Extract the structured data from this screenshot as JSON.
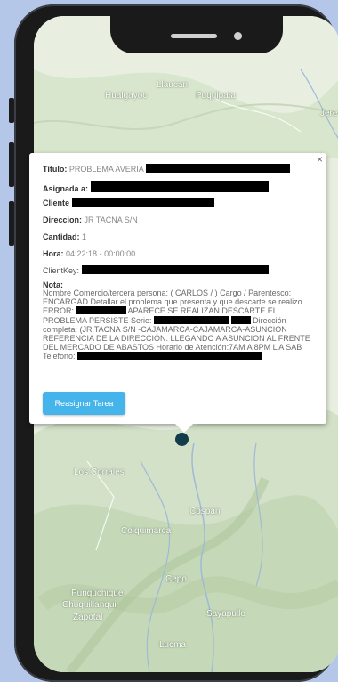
{
  "map": {
    "labels": {
      "llaucan": "Llaucan",
      "hualgayoc": "Hualgayoc",
      "puquipata": "Puquipata",
      "jere": "Jere",
      "los_corrales": "Los Corrales",
      "cospan": "Cospan",
      "colquimarca": "Colquimarca",
      "cepo": "Cepo",
      "punguchique": "Punguchique",
      "chuquillanqui": "Chuquillanqui",
      "zapotal": "Zapotal",
      "sayapullo": "Sayapullo",
      "lucma": "Lucma"
    }
  },
  "popup": {
    "close_symbol": "×",
    "titulo_label": "Titulo:",
    "titulo_value": "PROBLEMA AVERIA",
    "asignada_label": "Asignada a:",
    "cliente_label": "Cliente",
    "direccion_label": "Direccion:",
    "direccion_value": "JR TACNA S/N",
    "cantidad_label": "Cantidad:",
    "cantidad_value": "1",
    "hora_label": "Hora:",
    "hora_value": "04:22:18 - 00:00:00",
    "clientkey_label": "ClientKey:",
    "nota_label": "Nota:",
    "nota_part1": "Nombre Comercio/tercera persona: ( CARLOS / ) Cargo / Parentesco: ENCARGAD Detallar el problema que presenta y que descarte se realizo ERROR:",
    "nota_part2": "APARECE SE REALIZAN DESCARTE EL PROBLEMA PERSISTE Serie:",
    "nota_part3": "Dirección completa: (JR TACNA S/N -CAJAMARCA-CAJAMARCA-ASUNCION REFERENCIA DE LA DIRECCIÓN: LLEGANDO A ASUNCION AL FRENTE DEL MERCADO DE ABASTOS Horario de Atención:7AM A 8PM L A SAB Telefono:",
    "assign_button": "Reasignar Tarea"
  },
  "colors": {
    "button": "#45b4ea",
    "pin": "#123c4a",
    "background": "#b5c7e8"
  }
}
